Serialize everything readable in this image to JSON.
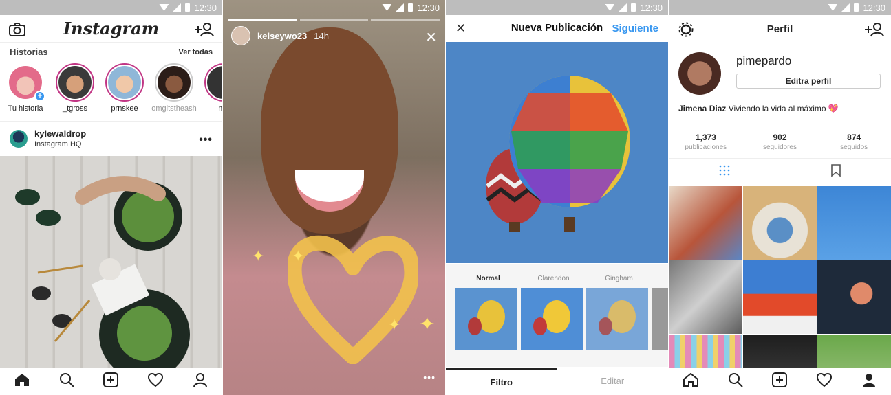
{
  "status": {
    "time": "12:30"
  },
  "feed": {
    "logo": "Instagram",
    "stories_title": "Historias",
    "see_all": "Ver todas",
    "stories": [
      {
        "name": "Tu historia"
      },
      {
        "name": "_tgross"
      },
      {
        "name": "prnskee"
      },
      {
        "name": "omgitstheash"
      },
      {
        "name": "mo"
      }
    ],
    "post": {
      "username": "kylewaldrop",
      "location": "Instagram HQ"
    }
  },
  "story": {
    "username": "kelseywo23",
    "time": "14h"
  },
  "new_post": {
    "title": "Nueva Publicación",
    "next": "Siguiente",
    "filters": [
      "Normal",
      "Clarendon",
      "Gingham"
    ],
    "tabs": [
      "Filtro",
      "Editar"
    ]
  },
  "profile": {
    "title": "Perfil",
    "username": "pimepardo",
    "edit": "Editra perfil",
    "bio_name": "Jimena Diaz",
    "bio_text": "Viviendo la vida al máximo 💖",
    "stats": [
      {
        "value": "1,373",
        "label": "publicaciones"
      },
      {
        "value": "902",
        "label": "seguidores"
      },
      {
        "value": "874",
        "label": "seguidos"
      }
    ]
  },
  "colors": {
    "accent": "#3897f0",
    "story_ring": "#c13584"
  }
}
